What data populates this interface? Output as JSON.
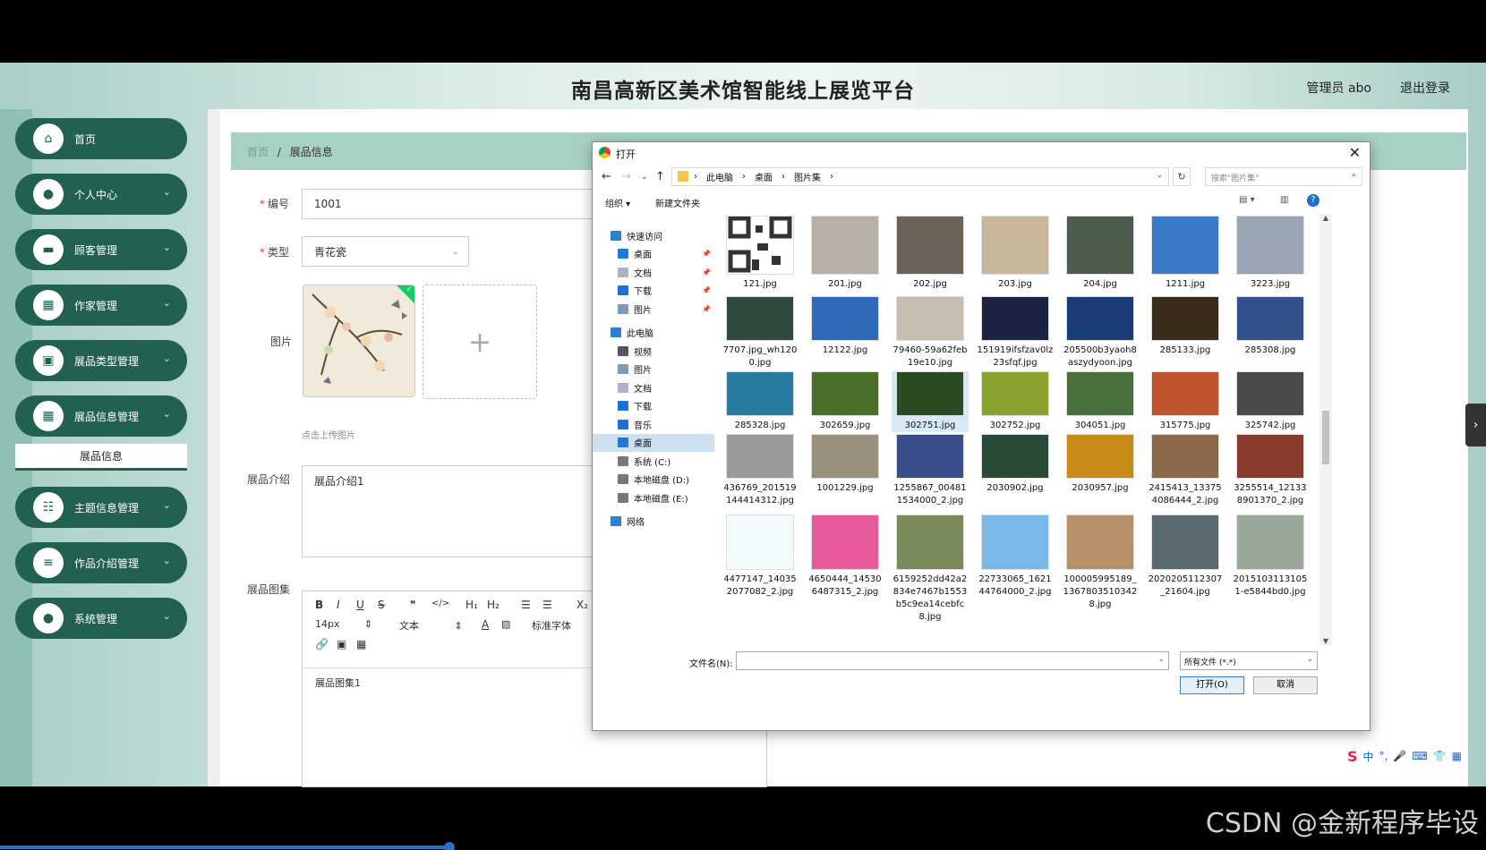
{
  "app": {
    "title": "南昌高新区美术馆智能线上展览平台",
    "user": "管理员 abo",
    "logout": "退出登录"
  },
  "sidebar": {
    "items": [
      {
        "label": "首页",
        "icon": "home-icon"
      },
      {
        "label": "个人中心",
        "icon": "user-icon"
      },
      {
        "label": "顾客管理",
        "icon": "monitor-icon"
      },
      {
        "label": "作家管理",
        "icon": "grid-icon"
      },
      {
        "label": "展品类型管理",
        "icon": "bag-icon"
      },
      {
        "label": "展品信息管理",
        "icon": "grid-icon"
      }
    ],
    "sub_item": "展品信息",
    "items2": [
      {
        "label": "主题信息管理",
        "icon": "sliders-icon"
      },
      {
        "label": "作品介绍管理",
        "icon": "list-icon"
      },
      {
        "label": "系统管理",
        "icon": "user-icon"
      }
    ]
  },
  "breadcrumb": {
    "home": "首页",
    "sep": "/",
    "current": "展品信息"
  },
  "form": {
    "id_label": "编号",
    "id_value": "1001",
    "type_label": "类型",
    "type_value": "青花瓷",
    "image_label": "图片",
    "upload_tip": "点击上传图片",
    "intro_label": "展品介绍",
    "intro_value": "展品介绍1",
    "gallery_label": "展品图集",
    "gallery_value": "展品图集1",
    "font_size": "14px",
    "text_style": "文本",
    "font_family": "标准字体"
  },
  "dialog": {
    "title": "打开",
    "path": [
      "此电脑",
      "桌面",
      "图片集"
    ],
    "search_placeholder": "搜索\"图片集\"",
    "organize": "组织 ▾",
    "new_folder": "新建文件夹",
    "tree": [
      {
        "label": "快速访问",
        "top": true,
        "color": "#2d7fd3"
      },
      {
        "label": "桌面",
        "pin": true,
        "color": "#1e7ad6"
      },
      {
        "label": "文档",
        "pin": true,
        "color": "#a7b5c4"
      },
      {
        "label": "下载",
        "pin": true,
        "color": "#1e6fd6"
      },
      {
        "label": "图片",
        "pin": true,
        "color": "#7f9bb8"
      },
      {
        "label": "此电脑",
        "top": true,
        "color": "#2d7fd3"
      },
      {
        "label": "视频",
        "color": "#556"
      },
      {
        "label": "图片",
        "color": "#7f9bb8"
      },
      {
        "label": "文档",
        "color": "#a7b5c4"
      },
      {
        "label": "下载",
        "color": "#1e6fd6"
      },
      {
        "label": "音乐",
        "color": "#1e6fd6"
      },
      {
        "label": "桌面",
        "color": "#1e7ad6",
        "sel": true
      },
      {
        "label": "系统 (C:)",
        "color": "#777"
      },
      {
        "label": "本地磁盘 (D:)",
        "color": "#777"
      },
      {
        "label": "本地磁盘 (E:)",
        "color": "#777"
      },
      {
        "label": "网络",
        "top": true,
        "color": "#2d7fd3"
      }
    ],
    "files": [
      [
        "121.jpg",
        "201.jpg",
        "202.jpg",
        "203.jpg",
        "204.jpg",
        "1211.jpg",
        "3223.jpg"
      ],
      [
        "7707.jpg_wh1200.jpg",
        "12122.jpg",
        "79460-59a62feb19e10.jpg",
        "151919ifsfzav0lz23sfqf.jpg",
        "205500b3yaoh8aszydyoon.jpg",
        "285133.jpg",
        "285308.jpg"
      ],
      [
        "285328.jpg",
        "302659.jpg",
        "302751.jpg",
        "302752.jpg",
        "304051.jpg",
        "315775.jpg",
        "325742.jpg"
      ],
      [
        "436769_201519144414312.jpg",
        "1001229.jpg",
        "1255867_004811534000_2.jpg",
        "2030902.jpg",
        "2030957.jpg",
        "2415413_133754086444_2.jpg",
        "3255514_121338901370_2.jpg"
      ],
      [
        "4477147_140352077082_2.jpg",
        "4650444_145306487315_2.jpg",
        "6159252dd42a2834e7467b1553b5c9ea14cebfc8.jpg",
        "22733065_162144764000_2.jpg",
        "100005995189_13678035103428.jpg",
        "2020205112307_21604.jpg",
        "20151031131051-e5844bd0.jpg"
      ]
    ],
    "file_colors": [
      [
        "#333",
        "#b7b0a7",
        "#6c6258",
        "#c9b79b",
        "#4d5d4b",
        "#3a7ac9",
        "#9aa5b3"
      ],
      [
        "#2f4a3c",
        "#2f6bb8",
        "#c7bdb0",
        "#1a2440",
        "#1a3d75",
        "#3a2b1a",
        "#31528d"
      ],
      [
        "#2a7ba0",
        "#4c6e2d",
        "#2c4a24",
        "#8aa32f",
        "#4a6e3c",
        "#c0542a",
        "#4a4a4a"
      ],
      [
        "#9a9a9a",
        "#9a8e7c",
        "#3a4f8a",
        "#2b4a38",
        "#c98a1a",
        "#8a6a4a",
        "#8a3a2a"
      ],
      [
        "#f4fbff",
        "#e85a9a",
        "#7a8a5a",
        "#7ab8e8",
        "#b7906a",
        "#5c6a72",
        "#9aa89a"
      ]
    ],
    "selected_file": "302751.jpg",
    "filename_label": "文件名(N):",
    "filetype": "所有文件 (*.*)",
    "open_btn": "打开(O)",
    "cancel_btn": "取消"
  },
  "watermark": "CSDN @金新程序毕设",
  "ime_label": "中"
}
